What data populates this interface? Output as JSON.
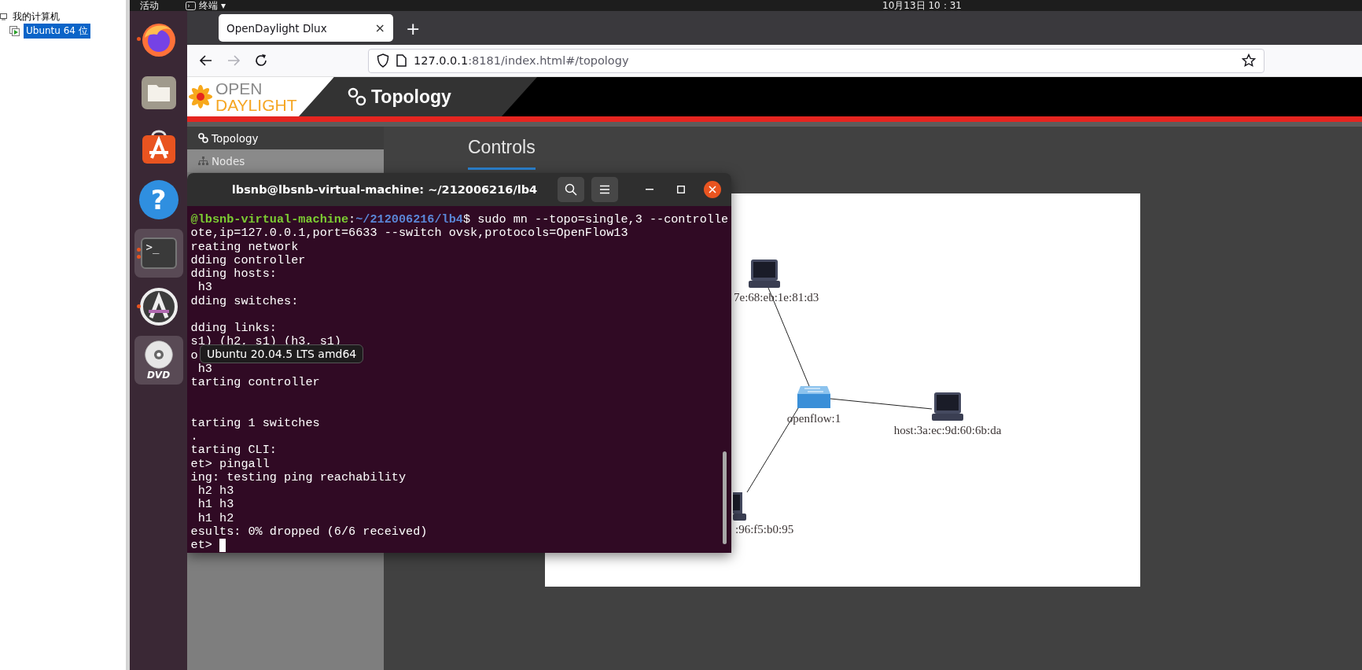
{
  "vm_library": {
    "items": [
      {
        "label": "我的计算机",
        "selected": false,
        "children": [
          {
            "label": "Ubuntu 64 位",
            "selected": true
          }
        ]
      }
    ]
  },
  "top_bar": {
    "activities": "活动",
    "app_menu": "终端",
    "app_menu_caret": "▾",
    "clock": "10月13日 10：31"
  },
  "dock": {
    "items": [
      {
        "kind": "firefox",
        "running": true,
        "multiple": false,
        "highlighted": false
      },
      {
        "kind": "files",
        "running": false,
        "multiple": false,
        "highlighted": false
      },
      {
        "kind": "software",
        "running": false,
        "multiple": false,
        "highlighted": false
      },
      {
        "kind": "help",
        "glyph": "?",
        "running": false,
        "multiple": false,
        "highlighted": false
      },
      {
        "kind": "terminal",
        "glyph": ">_",
        "running": true,
        "multiple": true,
        "highlighted": true
      },
      {
        "kind": "updater",
        "running": true,
        "multiple": false,
        "highlighted": false
      },
      {
        "kind": "dvd",
        "label": "DVD",
        "running": false,
        "multiple": false,
        "highlighted": true
      }
    ]
  },
  "tooltip": "Ubuntu 20.04.5 LTS amd64",
  "browser": {
    "tabs": [
      {
        "title": "OpenDaylight Dlux",
        "selected": true
      }
    ],
    "close_tab": "×",
    "new_tab": "+",
    "forward_disabled": true,
    "url_host": "127.0.0.1",
    "url_rest": ":8181/index.html#/topology"
  },
  "app": {
    "logo": {
      "line_1": "OPEN",
      "line_2": "DAYLIGHT"
    },
    "page_title": "Topology",
    "sidebar": [
      {
        "label": "Topology",
        "selected": true
      },
      {
        "label": "Nodes",
        "selected": false
      }
    ],
    "heading": "Controls",
    "topology": {
      "nodes": [
        {
          "kind": "host",
          "label": "7e:68:eb:1e:81:d3"
        },
        {
          "kind": "switch",
          "label": "openflow:1"
        },
        {
          "kind": "host",
          "label": "host:3a:ec:9d:60:6b:da"
        },
        {
          "kind": "host_partial",
          "label": ":96:f5:b0:95"
        }
      ]
    }
  },
  "terminal": {
    "title": "lbsnb@lbsnb-virtual-machine: ~/212006216/lb4",
    "prompt": {
      "user_host": "@lbsnb-virtual-machine",
      "separator": ":",
      "path": "~/212006216/lb4",
      "command": "$ sudo mn --topo=single,3 --controlle"
    },
    "lines": [
      {
        "kind": "output",
        "text": "ote,ip=127.0.0.1,port=6633 --switch ovsk,protocols=OpenFlow13"
      },
      {
        "kind": "output",
        "text": "reating network"
      },
      {
        "kind": "output",
        "text": "dding controller"
      },
      {
        "kind": "output",
        "text": "dding hosts:"
      },
      {
        "kind": "output",
        "text": " h3"
      },
      {
        "kind": "output",
        "text": "dding switches:"
      },
      {
        "kind": "blank"
      },
      {
        "kind": "output",
        "text": "dding links:"
      },
      {
        "kind": "output",
        "text": "s1) (h2, s1) (h3, s1)"
      },
      {
        "kind": "output",
        "text": "o"
      },
      {
        "kind": "output",
        "text": " h3"
      },
      {
        "kind": "output",
        "text": "tarting controller"
      },
      {
        "kind": "blank"
      },
      {
        "kind": "blank"
      },
      {
        "kind": "output",
        "text": "tarting 1 switches"
      },
      {
        "kind": "output",
        "text": "."
      },
      {
        "kind": "output",
        "text": "tarting CLI:"
      },
      {
        "kind": "output",
        "text": "et> pingall"
      },
      {
        "kind": "output",
        "text": "ing: testing ping reachability"
      },
      {
        "kind": "output",
        "text": " h2 h3"
      },
      {
        "kind": "output",
        "text": " h1 h3"
      },
      {
        "kind": "output",
        "text": " h1 h2"
      },
      {
        "kind": "output",
        "text": "esults: 0% dropped (6/6 received)"
      },
      {
        "kind": "cursor",
        "text": "et>"
      }
    ]
  }
}
